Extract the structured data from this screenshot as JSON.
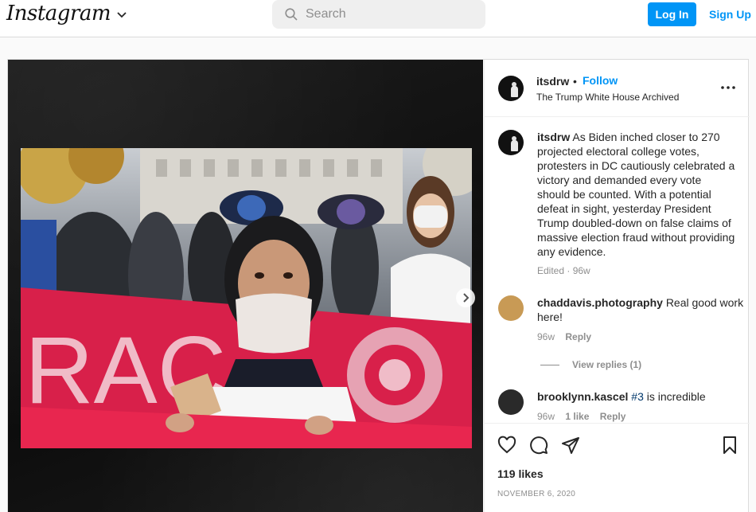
{
  "nav": {
    "logo": "Instagram",
    "search_placeholder": "Search",
    "login_label": "Log In",
    "signup_label": "Sign Up"
  },
  "post": {
    "username": "itsdrw",
    "separator": "•",
    "follow_label": "Follow",
    "location": "The Trump White House Archived",
    "caption": {
      "username": "itsdrw",
      "text": "As Biden inched closer to 270 projected electoral college votes, protesters in DC cautiously celebrated a victory and demanded every vote should be counted. With a potential defeat in sight, yesterday President Trump doubled-down on false claims of massive election fraud without providing any evidence.",
      "edited": "Edited · 96w"
    },
    "comments": [
      {
        "username": "chaddavis.photography",
        "text": "Real good work here!",
        "time": "96w",
        "reply_label": "Reply",
        "view_replies": "View replies (1)"
      },
      {
        "username": "brooklynn.kascel",
        "tag": "#3",
        "text": "is incredible",
        "time": "96w",
        "likes": "1 like",
        "reply_label": "Reply"
      }
    ],
    "likes": "119 likes",
    "date": "NOVEMBER 6, 2020"
  },
  "icons": [
    "chevron-down-icon",
    "search-icon",
    "more-icon",
    "next-arrow-icon",
    "heart-icon",
    "comment-icon",
    "share-icon",
    "bookmark-icon"
  ],
  "colors": {
    "accent": "#0095f6",
    "text": "#262626",
    "muted": "#8e8e8e",
    "link": "#00376b"
  }
}
